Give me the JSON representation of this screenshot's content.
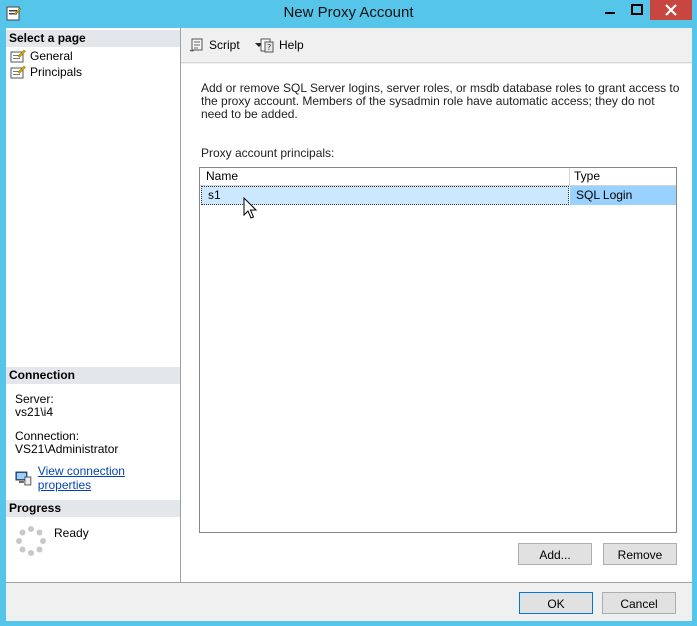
{
  "window": {
    "title": "New Proxy Account",
    "minimize_label": "minimize",
    "maximize_label": "maximize",
    "close_label": "close"
  },
  "left_panel": {
    "select_page_heading": "Select a page",
    "pages": [
      {
        "label": "General",
        "icon": "page-wrench-icon"
      },
      {
        "label": "Principals",
        "icon": "page-wrench-icon"
      }
    ],
    "connection_heading": "Connection",
    "server_label": "Server:",
    "server_value": "vs21\\i4",
    "connection_label": "Connection:",
    "connection_value": "VS21\\Administrator",
    "view_connection_link": "View connection properties",
    "progress_heading": "Progress",
    "progress_status": "Ready"
  },
  "toolbar": {
    "script_label": "Script",
    "help_label": "Help"
  },
  "principals": {
    "description": "Add or remove SQL Server logins, server roles, or msdb database roles to grant access to the proxy account. Members of the sysadmin role have automatic access; they do not need to be added.",
    "list_label": "Proxy account principals:",
    "columns": {
      "name": "Name",
      "type": "Type"
    },
    "rows": [
      {
        "name": "s1",
        "type": "SQL Login"
      }
    ],
    "add_button": "Add...",
    "remove_button": "Remove"
  },
  "footer": {
    "ok_button": "OK",
    "cancel_button": "Cancel"
  },
  "colors": {
    "frame": "#56c5ea",
    "close_button": "#c7463f",
    "selection": "#cce8ff",
    "selection_type": "#99d1ff",
    "link": "#0645ad"
  }
}
